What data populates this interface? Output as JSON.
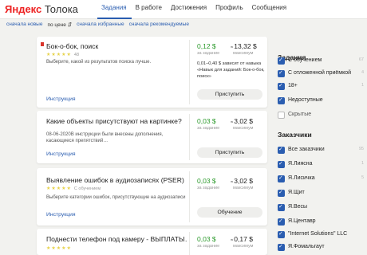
{
  "header": {
    "logo_brand": "Яндекс",
    "logo_product": "Толока",
    "nav": [
      {
        "label": "Задания",
        "active": true
      },
      {
        "label": "В работе",
        "active": false
      },
      {
        "label": "Достижения",
        "active": false
      },
      {
        "label": "Профиль",
        "active": false
      },
      {
        "label": "Сообщения",
        "active": false
      }
    ]
  },
  "sort": [
    "сначала новые",
    "по цене ⇵",
    "сначала избранные",
    "сначала рекомендуемые"
  ],
  "tasks": [
    {
      "title": "Бок-о-бок, поиск",
      "stars": "★★★★★",
      "rating_count": "48",
      "description": "Выберите, какой из результатов поиска лучше.",
      "instruction": "Инструкция",
      "price": "0,12",
      "price_label": "за задание",
      "max": "13,32",
      "max_label": "максимум",
      "note": "0,01–0,40 $ зависит от навыка «Навык для заданий: Бок-о-бок, поиск»",
      "button": "Приступить",
      "currency": "$",
      "approx": "≈"
    },
    {
      "title": "Какие объекты присутствуют на картинке?",
      "stars": "",
      "rating_count": "",
      "description": "08-06-2020В инструкции были внесены дополнения, касающиеся препятствий…",
      "instruction": "Инструкция",
      "price": "0,03",
      "price_label": "за задание",
      "max": "3,02",
      "max_label": "максимум",
      "note": "",
      "button": "Приступить",
      "currency": "$",
      "approx": "≈"
    },
    {
      "title": "Выявление ошибок в аудиозаписях (PSER)",
      "stars": "★★★★★",
      "rating_count": "С обучением",
      "description": "Выберите категории ошибок, присутствующие на аудиозаписи",
      "instruction": "Инструкция",
      "price": "0,03",
      "price_label": "за задание",
      "max": "3,02",
      "max_label": "максимум",
      "note": "",
      "button": "Обучение",
      "currency": "$",
      "approx": "≈"
    },
    {
      "title": "Поднести телефон под камеру - ВЫПЛАТЫ…",
      "stars": "★★★★★",
      "rating_count": "",
      "description": "",
      "instruction": "",
      "price": "0,03",
      "price_label": "за задание",
      "max": "0,17",
      "max_label": "максимум",
      "note": "",
      "button": "",
      "currency": "$",
      "approx": "≈"
    }
  ],
  "sidebar": {
    "tasks_title": "Задания",
    "task_filters": [
      {
        "label": "С обучением",
        "count": "67",
        "checked": true
      },
      {
        "label": "С отложенной приёмкой",
        "count": "4",
        "checked": true
      },
      {
        "label": "18+",
        "count": "1",
        "checked": true
      },
      {
        "label": "Недоступные",
        "count": "",
        "checked": true
      },
      {
        "label": "Скрытые",
        "count": "",
        "checked": false
      }
    ],
    "requesters_title": "Заказчики",
    "requesters": [
      {
        "label": "Все заказчики",
        "count": "95",
        "checked": true
      },
      {
        "label": "Я.Лиясна",
        "count": "1",
        "checked": true
      },
      {
        "label": "Я.Лисичка",
        "count": "5",
        "checked": true
      },
      {
        "label": "Я.Щит",
        "count": "",
        "checked": true
      },
      {
        "label": "Я.Весы",
        "count": "",
        "checked": true
      },
      {
        "label": "Я.Центавр",
        "count": "",
        "checked": true
      },
      {
        "label": "\"Internet Solutions\" LLC",
        "count": "",
        "checked": true
      },
      {
        "label": "Я.Фомальгаут",
        "count": "",
        "checked": true
      }
    ]
  }
}
